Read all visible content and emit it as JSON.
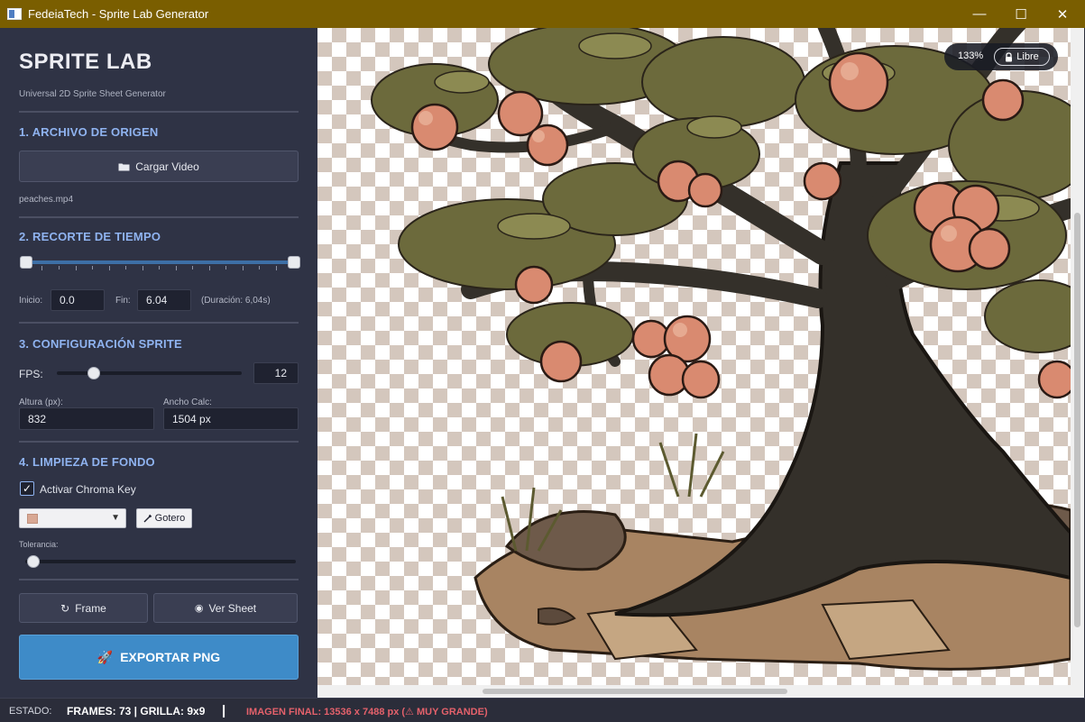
{
  "window": {
    "title": "FedeiaTech - Sprite Lab Generator",
    "minimize": "—",
    "maximize": "☐",
    "close": "✕"
  },
  "brand": {
    "title": "SPRITE LAB",
    "subtitle": "Universal 2D Sprite Sheet Generator"
  },
  "source": {
    "title": "1. ARCHIVO DE ORIGEN",
    "load_button": "Cargar Video",
    "load_icon": "folder-icon",
    "filename": "peaches.mp4"
  },
  "trim": {
    "title": "2. RECORTE DE TIEMPO",
    "start_label": "Inicio:",
    "start_value": "0.0",
    "end_label": "Fin:",
    "end_value": "6.04",
    "duration": "(Duración: 6,04s)",
    "range_start_fraction": 0.0,
    "range_end_fraction": 1.0
  },
  "sprite": {
    "title": "3. CONFIGURACIÓN SPRITE",
    "fps_label": "FPS:",
    "fps_value": "12",
    "fps_slider_fraction": 0.2,
    "height_label": "Altura (px):",
    "height_value": "832",
    "width_label": "Ancho Calc:",
    "width_value": "1504 px"
  },
  "cleanup": {
    "title": "4. LIMPIEZA DE FONDO",
    "chroma_label": "Activar Chroma Key",
    "chroma_checked": true,
    "key_color": "#d8a894",
    "dropper_button": "Gotero",
    "tolerance_label": "Tolerancia:",
    "tolerance_fraction": 0.03
  },
  "actions": {
    "frame_button": "Frame",
    "sheet_button": "Ver Sheet",
    "export_button": "EXPORTAR PNG"
  },
  "preview": {
    "zoom": "133%",
    "lock_label": "Libre"
  },
  "status": {
    "label": "ESTADO:",
    "frames_grid": "FRAMES: 73  |  GRILLA: 9x9",
    "separator": "|",
    "warning": "IMAGEN FINAL: 13536 x 7488 px (⚠ MUY GRANDE)"
  },
  "colors": {
    "accent": "#8fb3f0",
    "export": "#3e8bc8",
    "warning": "#e4616b",
    "titlebar": "#7a5e00"
  }
}
